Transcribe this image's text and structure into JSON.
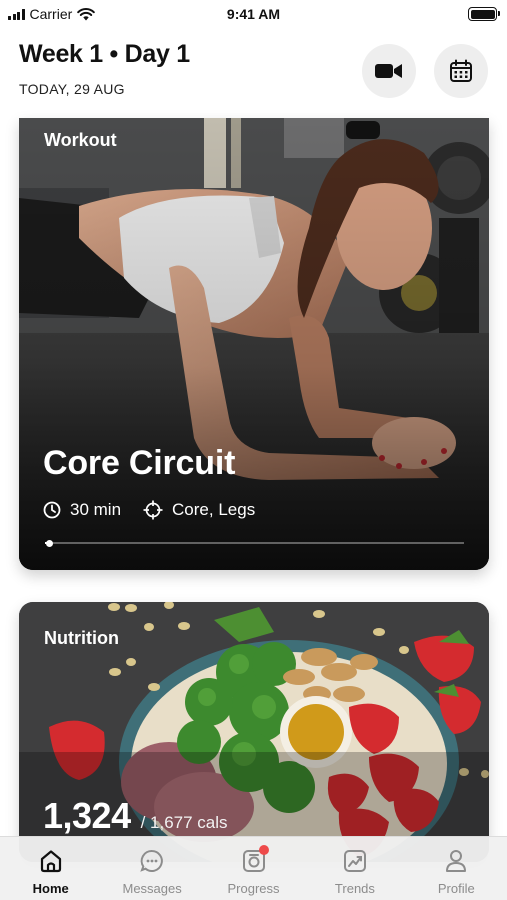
{
  "status_bar": {
    "carrier": "Carrier",
    "time": "9:41 AM"
  },
  "header": {
    "title": "Week 1 • Day 1",
    "date": "TODAY, 29 AUG",
    "video_icon": "video-camera-icon",
    "calendar_icon": "calendar-icon"
  },
  "workout": {
    "label": "Workout",
    "title": "Core Circuit",
    "duration": "30 min",
    "focus": "Core, Legs",
    "duration_icon": "clock-icon",
    "focus_icon": "crosshair-icon",
    "progress_fraction": 0.01
  },
  "nutrition": {
    "label": "Nutrition",
    "calories": "1,324",
    "calories_target": "/ 1,677 cals"
  },
  "tabs": [
    {
      "label": "Home",
      "icon": "home-icon",
      "active": true
    },
    {
      "label": "Messages",
      "icon": "chat-bubble-icon",
      "active": false
    },
    {
      "label": "Progress",
      "icon": "progress-camera-icon",
      "active": false,
      "badge": true
    },
    {
      "label": "Trends",
      "icon": "trend-chart-icon",
      "active": false
    },
    {
      "label": "Profile",
      "icon": "person-icon",
      "active": false
    }
  ],
  "colors": {
    "accent": "#111111",
    "inactive": "#8c8c8c",
    "badge": "#ee4a4a"
  }
}
